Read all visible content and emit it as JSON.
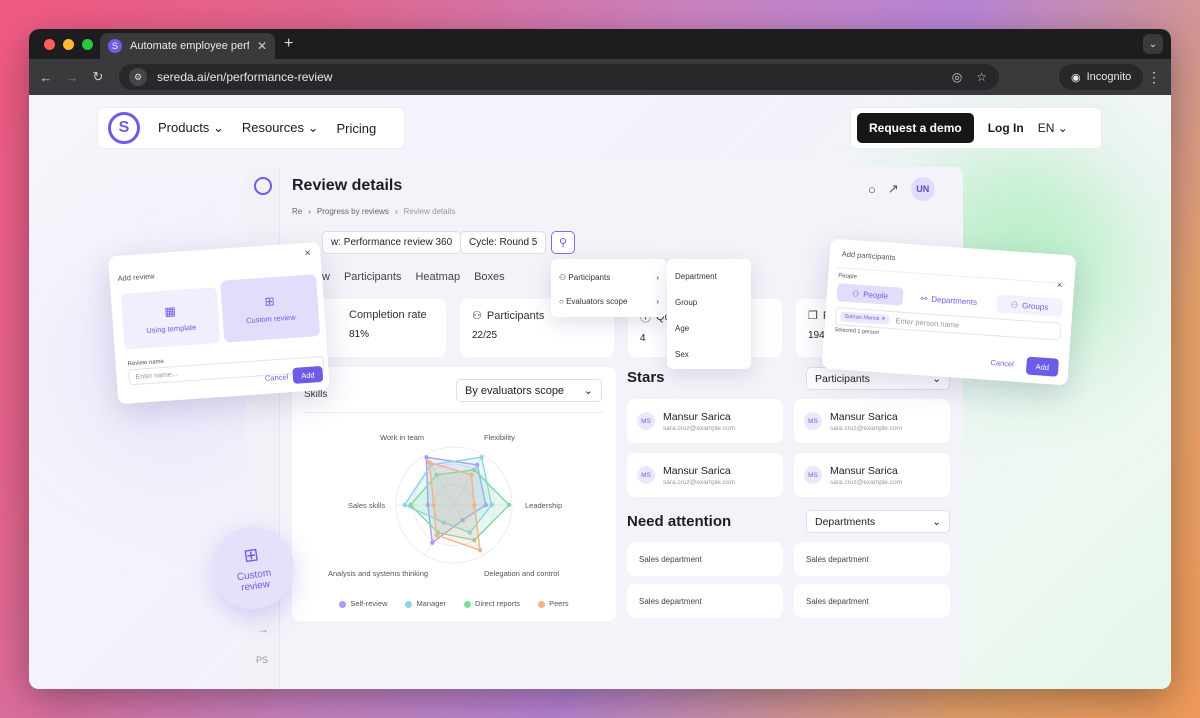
{
  "browser": {
    "tab_title": "Automate employee performa",
    "url": "sereda.ai/en/performance-review",
    "incognito_label": "Incognito"
  },
  "site_nav": {
    "items": [
      "Products",
      "Resources",
      "Pricing"
    ],
    "demo_label": "Request a demo",
    "login_label": "Log In",
    "lang": "EN"
  },
  "app": {
    "title": "Review details",
    "avatar": "UN",
    "breadcrumbs": [
      "Re",
      "Progress by reviews",
      "Review details"
    ],
    "review_chip": "w: Performance review 360",
    "cycle_chip": "Cycle: Round 5",
    "tabs": [
      "w",
      "Participants",
      "Heatmap",
      "Boxes"
    ],
    "stats": [
      {
        "label": "Completion rate",
        "value": "81%"
      },
      {
        "label": "Participants",
        "value": "22/25"
      },
      {
        "label": "Qu",
        "value": "4"
      },
      {
        "label": "Re",
        "value": "194"
      }
    ],
    "skills": {
      "label": "Skills",
      "scope_select": "By evaluators scope",
      "axes": [
        "Work in team",
        "Flexibility",
        "Leadership",
        "Delegation and control",
        "Analysis and systems thinking",
        "Sales skills"
      ],
      "legend": [
        {
          "name": "Self-review",
          "color": "#a99cf2"
        },
        {
          "name": "Manager",
          "color": "#8fd3e8"
        },
        {
          "name": "Direct reports",
          "color": "#7fd9a4"
        },
        {
          "name": "Peers",
          "color": "#f2b483"
        }
      ]
    },
    "stars": {
      "title": "Stars",
      "filter": "Participants",
      "people": [
        {
          "initials": "MS",
          "name": "Mansur Sarica",
          "email": "sara.cruz@example.com"
        },
        {
          "initials": "MS",
          "name": "Mansur Sarica",
          "email": "sara.cruz@example.com"
        },
        {
          "initials": "MS",
          "name": "Mansur Sarica",
          "email": "sara.cruz@example.com"
        },
        {
          "initials": "MS",
          "name": "Mansur Sarica",
          "email": "sara.cruz@example.com"
        }
      ]
    },
    "attention": {
      "title": "Need attention",
      "filter": "Departments",
      "items": [
        "Sales department",
        "Sales department",
        "Sales department",
        "Sales department"
      ]
    },
    "filter_menu": {
      "items": [
        "Participants",
        "Evaluators scope"
      ],
      "sub_items": [
        "Department",
        "Group",
        "Age",
        "Sex"
      ]
    }
  },
  "add_review": {
    "title": "Add review",
    "options": [
      "Using template",
      "Custom review"
    ],
    "field_label": "Review name",
    "placeholder": "Enter name...",
    "cancel": "Cancel",
    "add": "Add"
  },
  "add_participants": {
    "title": "Add participants",
    "section": "People",
    "tabs": [
      "People",
      "Departments",
      "Groups"
    ],
    "tag": "Sukran Memis",
    "placeholder": "Enter person name",
    "selected": "Selected 1 person",
    "cancel": "Cancel",
    "add": "Add"
  },
  "custom_badge": "Custom review",
  "chart_data": {
    "type": "radar",
    "axes": [
      "Work in team",
      "Flexibility",
      "Leadership",
      "Delegation and control",
      "Analysis and systems thinking",
      "Sales skills"
    ],
    "series": [
      {
        "name": "Self-review",
        "values": [
          0.95,
          0.8,
          0.55,
          0.3,
          0.75,
          0.45
        ]
      },
      {
        "name": "Manager",
        "values": [
          0.8,
          0.95,
          0.65,
          0.55,
          0.35,
          0.85
        ]
      },
      {
        "name": "Direct reports",
        "values": [
          0.6,
          0.7,
          0.95,
          0.7,
          0.55,
          0.75
        ]
      },
      {
        "name": "Peers",
        "values": [
          0.85,
          0.6,
          0.35,
          0.9,
          0.6,
          0.35
        ]
      }
    ],
    "range": [
      0,
      1
    ]
  }
}
